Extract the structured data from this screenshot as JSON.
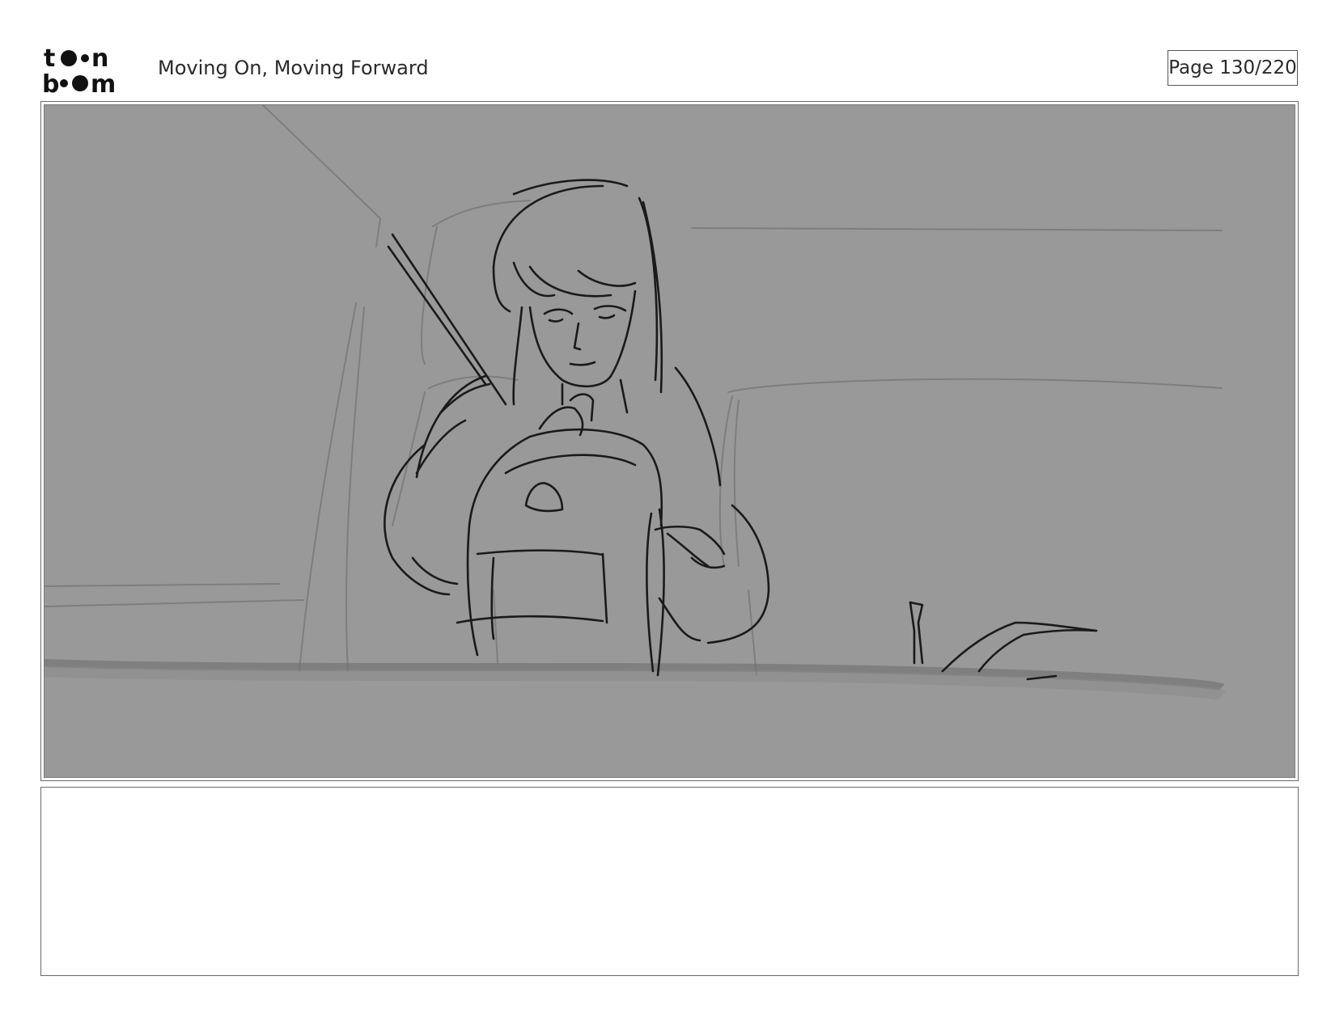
{
  "header": {
    "logo_text": "toon boom",
    "title": "Moving On, Moving Forward",
    "page_label": "Page 130/220"
  },
  "panel": {
    "background_color": "#999999",
    "line_color": "#1a1a1a",
    "construction_line_color": "#808080"
  },
  "notes": {
    "text": ""
  }
}
